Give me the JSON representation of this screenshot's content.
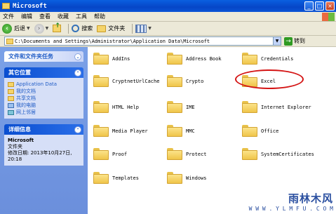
{
  "window": {
    "title": "Microsoft"
  },
  "menu": [
    "文件",
    "编辑",
    "查看",
    "收藏",
    "工具",
    "帮助"
  ],
  "toolbar": {
    "back": "后退",
    "search": "搜索",
    "folders": "文件夹"
  },
  "address": {
    "path": "C:\\Documents and Settings\\Administrator\\Application Data\\Microsoft",
    "go": "转到"
  },
  "tasks": {
    "file_tasks": "文件和文件夹任务",
    "other_places": "其它位置",
    "places": [
      "Application Data",
      "我的文档",
      "共享文档",
      "我的电脑",
      "网上邻居"
    ],
    "details_title": "详细信息",
    "details": {
      "name": "Microsoft",
      "type": "文件夹",
      "modified": "修改日期: 2013年10月27日, 20:18"
    }
  },
  "folders": [
    "AddIns",
    "Address Book",
    "Credentials",
    "CryptnetUrlCache",
    "Crypto",
    "Excel",
    "HTML Help",
    "IME",
    "Internet Explorer",
    "Media Player",
    "MMC",
    "Office",
    "Proof",
    "Protect",
    "SystemCertificates",
    "Templates",
    "Windows"
  ],
  "watermark": {
    "name": "雨林木风",
    "url": "W W W . Y L M F U . C O M"
  }
}
